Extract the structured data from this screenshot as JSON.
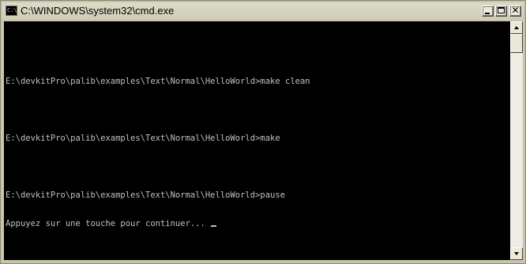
{
  "window": {
    "title": "C:\\WINDOWS\\system32\\cmd.exe",
    "icon": "cmd-icon",
    "icon_text": "C:\\"
  },
  "controls": {
    "minimize_icon": "minimize-icon",
    "maximize_icon": "maximize-icon",
    "close_icon": "close-icon",
    "close_glyph": "✕"
  },
  "console": {
    "lines": [
      "",
      "E:\\devkitPro\\palib\\examples\\Text\\Normal\\HelloWorld>make clean",
      "",
      "E:\\devkitPro\\palib\\examples\\Text\\Normal\\HelloWorld>make",
      "",
      "E:\\devkitPro\\palib\\examples\\Text\\Normal\\HelloWorld>pause",
      "Appuyez sur une touche pour continuer... "
    ],
    "text_color": "#c0c0c0",
    "background_color": "#000000"
  },
  "colors": {
    "frame": "#c8c4ad",
    "titlebar": "#dcdbc9"
  }
}
